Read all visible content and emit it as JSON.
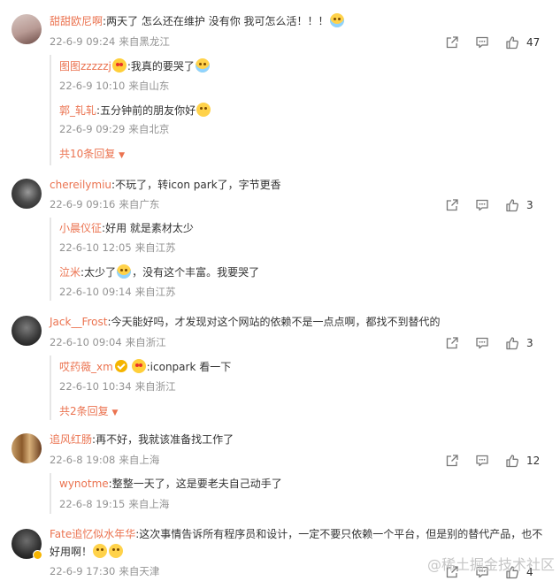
{
  "comments": [
    {
      "user": "甜甜欧尼啊",
      "text": "两天了 怎么还在维护 没有你 我可怎么活！！！",
      "date": "22-6-9 09:24",
      "location": "来自黑龙江",
      "likes": "47",
      "replies": [
        {
          "user": "图图zzzzzj",
          "text": "我真的要哭了",
          "date": "22-6-9 10:10",
          "location": "来自山东"
        },
        {
          "user": "郭_轧轧",
          "text": "五分钟前的朋友你好",
          "date": "22-6-9 09:29",
          "location": "来自北京"
        }
      ],
      "more": "共10条回复"
    },
    {
      "user": "chereilymiu",
      "text": "不玩了，转icon park了，字节更香",
      "date": "22-6-9 09:16",
      "location": "来自广东",
      "likes": "3",
      "replies": [
        {
          "user": "小晨仪征",
          "text": "好用  就是素材太少",
          "date": "22-6-10 12:05",
          "location": "来自江苏"
        },
        {
          "user": "泣米",
          "text": "太少了",
          "text2": "，没有这个丰富。我要哭了",
          "date": "22-6-10 09:14",
          "location": "来自江苏"
        }
      ]
    },
    {
      "user": "Jack__Frost",
      "text": "今天能好吗，才发现对这个网站的依赖不是一点点啊，都找不到替代的",
      "date": "22-6-10 09:04",
      "location": "来自浙江",
      "likes": "3",
      "replies": [
        {
          "user": "哎药薇_xm",
          "text": "iconpark 看一下",
          "date": "22-6-10 10:34",
          "location": "来自浙江"
        }
      ],
      "more": "共2条回复"
    },
    {
      "user": "追风红肠",
      "text": "再不好，我就该准备找工作了",
      "date": "22-6-8 19:08",
      "location": "来自上海",
      "likes": "12",
      "replies": [
        {
          "user": "wynotme",
          "text": "整整一天了，这是要老夫自己动手了",
          "date": "22-6-8 19:15",
          "location": "来自上海"
        }
      ]
    },
    {
      "user": "Fate追忆似水年华",
      "text": "这次事情告诉所有程序员和设计，一定不要只依赖一个平台，但是别的替代产品，也不",
      "text2": "好用啊！",
      "date": "22-6-9 17:30",
      "location": "来自天津",
      "likes": "4"
    }
  ],
  "watermark": "@稀土掘金技术社区",
  "colors": {
    "username": "#eb7350",
    "meta": "#939393",
    "text": "#333333"
  }
}
